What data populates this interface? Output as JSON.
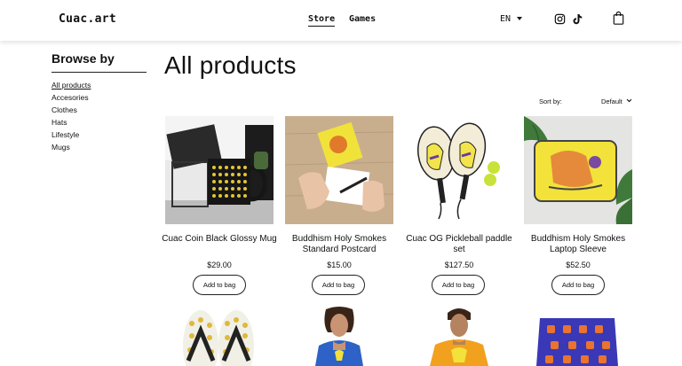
{
  "header": {
    "logo": "Cuac.art",
    "nav": [
      "Store",
      "Games"
    ],
    "language": "EN",
    "icons": [
      "instagram-icon",
      "tiktok-icon",
      "shopping-bag-icon"
    ]
  },
  "sidebar": {
    "title": "Browse by",
    "categories": [
      "All products",
      "Accesories",
      "Clothes",
      "Hats",
      "Lifestyle",
      "Mugs"
    ],
    "active": "All products"
  },
  "main": {
    "title": "All products",
    "sort_label": "Sort by:",
    "sort_value": "Default"
  },
  "products": [
    {
      "name": "Cuac Coin Black Glossy Mug",
      "price": "$29.00",
      "button": "Add to bag"
    },
    {
      "name": "Buddhism Holy Smokes Standard Postcard",
      "price": "$15.00",
      "button": "Add to bag"
    },
    {
      "name": "Cuac OG Pickleball paddle set",
      "price": "$127.50",
      "button": "Add to bag"
    },
    {
      "name": "Buddhism Holy Smokes Laptop Sleeve",
      "price": "$52.50",
      "button": "Add to bag"
    }
  ],
  "colors": {
    "accent": "#111111",
    "background": "#ffffff"
  }
}
